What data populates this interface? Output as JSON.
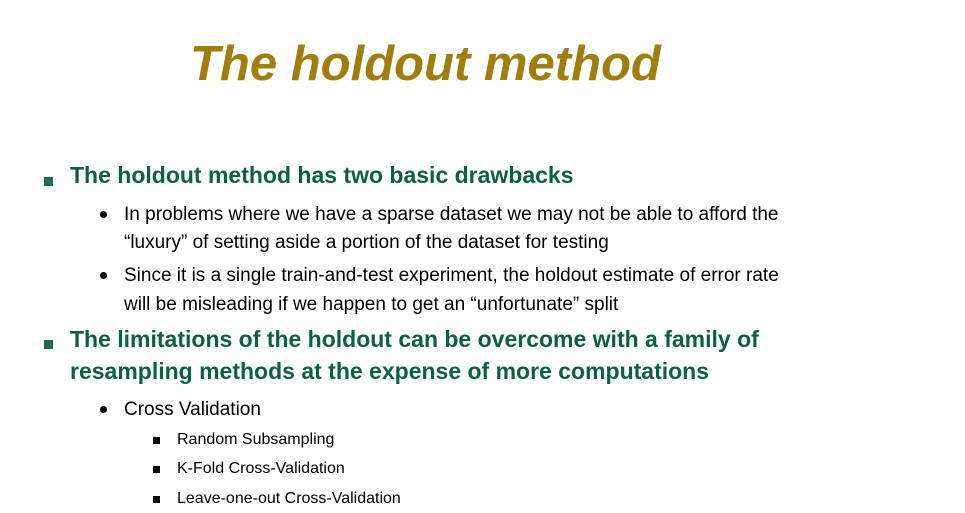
{
  "slide": {
    "title": "The holdout method",
    "points": [
      {
        "text": "The holdout method has two basic drawbacks",
        "subpoints": [
          {
            "line1": "In problems where we have a sparse dataset we may not be able to afford the",
            "line2": "“luxury” of setting aside a portion of the dataset for testing"
          },
          {
            "line1": "Since it is a single train-and-test experiment, the holdout estimate of error rate",
            "line2": "will be misleading if we happen to get an “unfortunate” split"
          }
        ]
      },
      {
        "line1": "The limitations of the holdout can be overcome with a family of",
        "line2": "resampling methods at the expense of more computations",
        "subpoints": [
          {
            "text": "Cross Validation",
            "items": [
              "Random Subsampling",
              "K-Fold Cross-Validation",
              "Leave-one-out Cross-Validation"
            ]
          }
        ]
      }
    ],
    "colors": {
      "title": "#a07e0e",
      "heading": "#0d5e47",
      "body": "#000000",
      "background": "#ffffff"
    }
  }
}
